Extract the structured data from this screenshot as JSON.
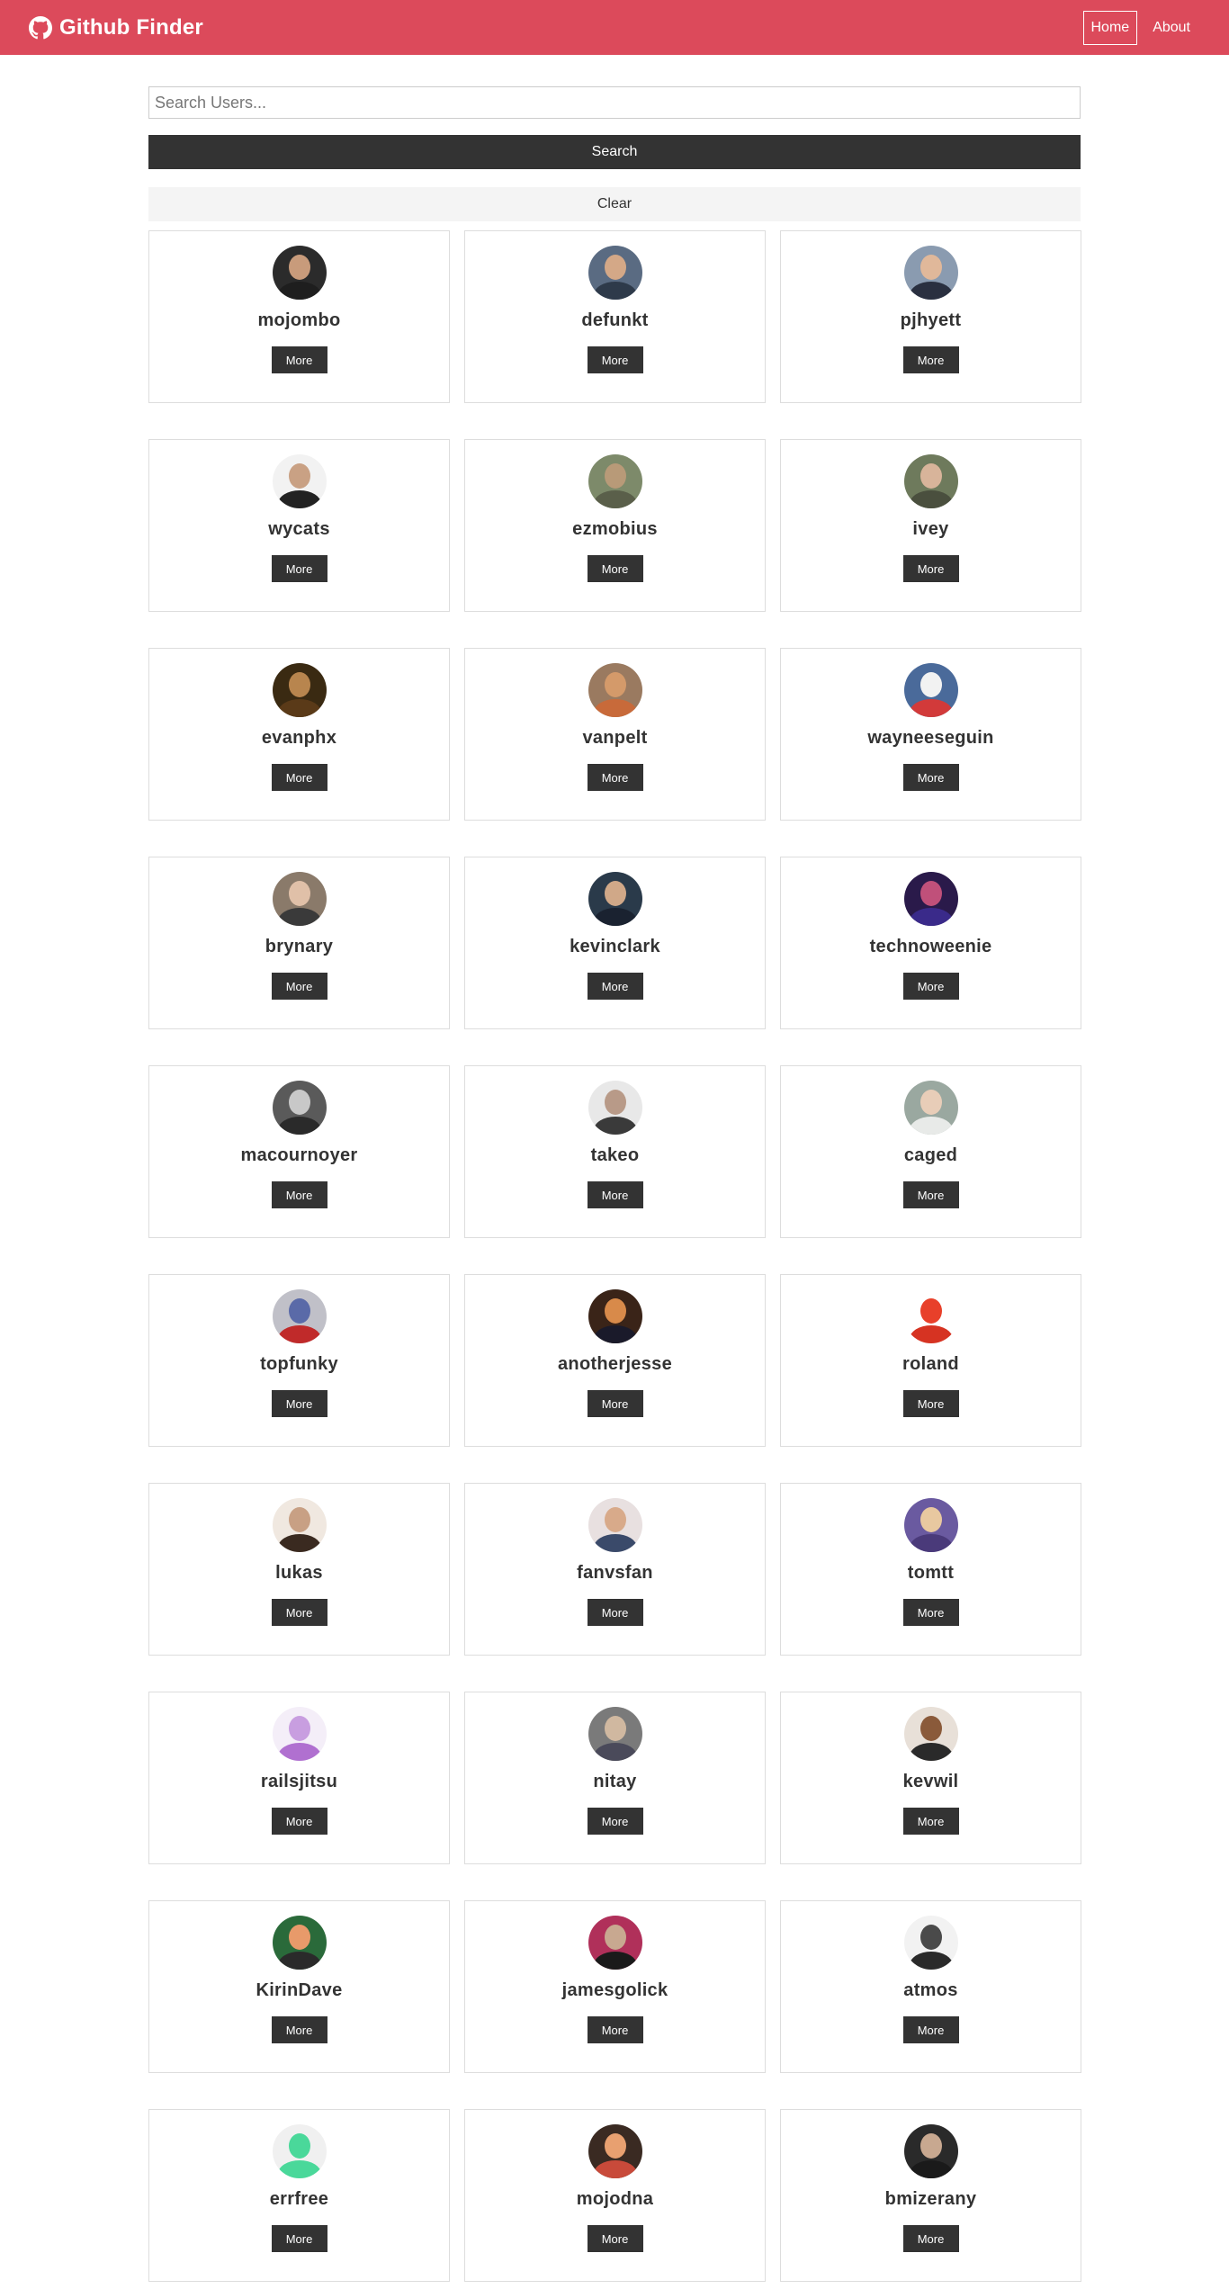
{
  "navbar": {
    "title": "Github Finder",
    "brand_color": "#dc4a5b",
    "links": [
      {
        "label": "Home",
        "active": true
      },
      {
        "label": "About",
        "active": false
      }
    ]
  },
  "search": {
    "placeholder": "Search Users...",
    "value": "",
    "button_label": "Search",
    "clear_label": "Clear"
  },
  "more_label": "More",
  "users": [
    {
      "login": "mojombo",
      "avatar_bg": "#2b2b2b",
      "skin": "#c89b7b",
      "shirt": "#1e1e1e"
    },
    {
      "login": "defunkt",
      "avatar_bg": "#5a6b82",
      "skin": "#d4a887",
      "shirt": "#2e3a4a"
    },
    {
      "login": "pjhyett",
      "avatar_bg": "#8a9bb0",
      "skin": "#e0b89a",
      "shirt": "#2a3040"
    },
    {
      "login": "wycats",
      "avatar_bg": "#f2f2f2",
      "skin": "#c9a184",
      "shirt": "#222222"
    },
    {
      "login": "ezmobius",
      "avatar_bg": "#7d8a6a",
      "skin": "#b89a78",
      "shirt": "#5a5f4a"
    },
    {
      "login": "ivey",
      "avatar_bg": "#6e7a5c",
      "skin": "#d8b49a",
      "shirt": "#4a4f3e"
    },
    {
      "login": "evanphx",
      "avatar_bg": "#3a2a12",
      "skin": "#b8854e",
      "shirt": "#5a3a18"
    },
    {
      "login": "vanpelt",
      "avatar_bg": "#9a7a60",
      "skin": "#d49a6a",
      "shirt": "#c86a3a"
    },
    {
      "login": "wayneeseguin",
      "avatar_bg": "#4a6a9a",
      "skin": "#f2f2f2",
      "shirt": "#d23a3a"
    },
    {
      "login": "brynary",
      "avatar_bg": "#8a7a6a",
      "skin": "#e0c0a8",
      "shirt": "#3a3a3a"
    },
    {
      "login": "kevinclark",
      "avatar_bg": "#2a3a4a",
      "skin": "#d0a888",
      "shirt": "#1a2230"
    },
    {
      "login": "technoweenie",
      "avatar_bg": "#2a1a4a",
      "skin": "#c0507a",
      "shirt": "#3a2a8a"
    },
    {
      "login": "macournoyer",
      "avatar_bg": "#5a5a5a",
      "skin": "#c8c8c8",
      "shirt": "#2a2a2a"
    },
    {
      "login": "takeo",
      "avatar_bg": "#e8e8e8",
      "skin": "#b89a88",
      "shirt": "#3a3a3a"
    },
    {
      "login": "caged",
      "avatar_bg": "#9aa8a0",
      "skin": "#e8cdb8",
      "shirt": "#e8eae8"
    },
    {
      "login": "topfunky",
      "avatar_bg": "#c0c0c8",
      "skin": "#5a6aa8",
      "shirt": "#c02a2a"
    },
    {
      "login": "anotherjesse",
      "avatar_bg": "#3a2418",
      "skin": "#d88a4a",
      "shirt": "#1a1a2a"
    },
    {
      "login": "roland",
      "avatar_bg": "#ffffff",
      "skin": "#e8402a",
      "shirt": "#d63322"
    },
    {
      "login": "lukas",
      "avatar_bg": "#f0e8e0",
      "skin": "#c8a084",
      "shirt": "#3a2a20"
    },
    {
      "login": "fanvsfan",
      "avatar_bg": "#e8e0e0",
      "skin": "#d8aa8a",
      "shirt": "#3a4a6a"
    },
    {
      "login": "tomtt",
      "avatar_bg": "#6a5aa0",
      "skin": "#e8c8a0",
      "shirt": "#4a3a7a"
    },
    {
      "login": "railsjitsu",
      "avatar_bg": "#f4eef8",
      "skin": "#c89ee0",
      "shirt": "#b070d0"
    },
    {
      "login": "nitay",
      "avatar_bg": "#7a7a7a",
      "skin": "#d0b8a0",
      "shirt": "#4a4a5a"
    },
    {
      "login": "kevwil",
      "avatar_bg": "#e8e0d8",
      "skin": "#8a5a3a",
      "shirt": "#2a2a2a"
    },
    {
      "login": "KirinDave",
      "avatar_bg": "#2a6a3a",
      "skin": "#e89a6a",
      "shirt": "#2a2a2a"
    },
    {
      "login": "jamesgolick",
      "avatar_bg": "#b0305a",
      "skin": "#c8a890",
      "shirt": "#1a1a1a"
    },
    {
      "login": "atmos",
      "avatar_bg": "#f2f2f2",
      "skin": "#4a4a4a",
      "shirt": "#2a2a2a"
    },
    {
      "login": "errfree",
      "avatar_bg": "#f0f0f0",
      "skin": "#4ad89a",
      "shirt": "#4ad89a"
    },
    {
      "login": "mojodna",
      "avatar_bg": "#3a2a22",
      "skin": "#e8a070",
      "shirt": "#c84a3a"
    },
    {
      "login": "bmizerany",
      "avatar_bg": "#2a2a2a",
      "skin": "#c8a890",
      "shirt": "#1a1a1a"
    }
  ]
}
